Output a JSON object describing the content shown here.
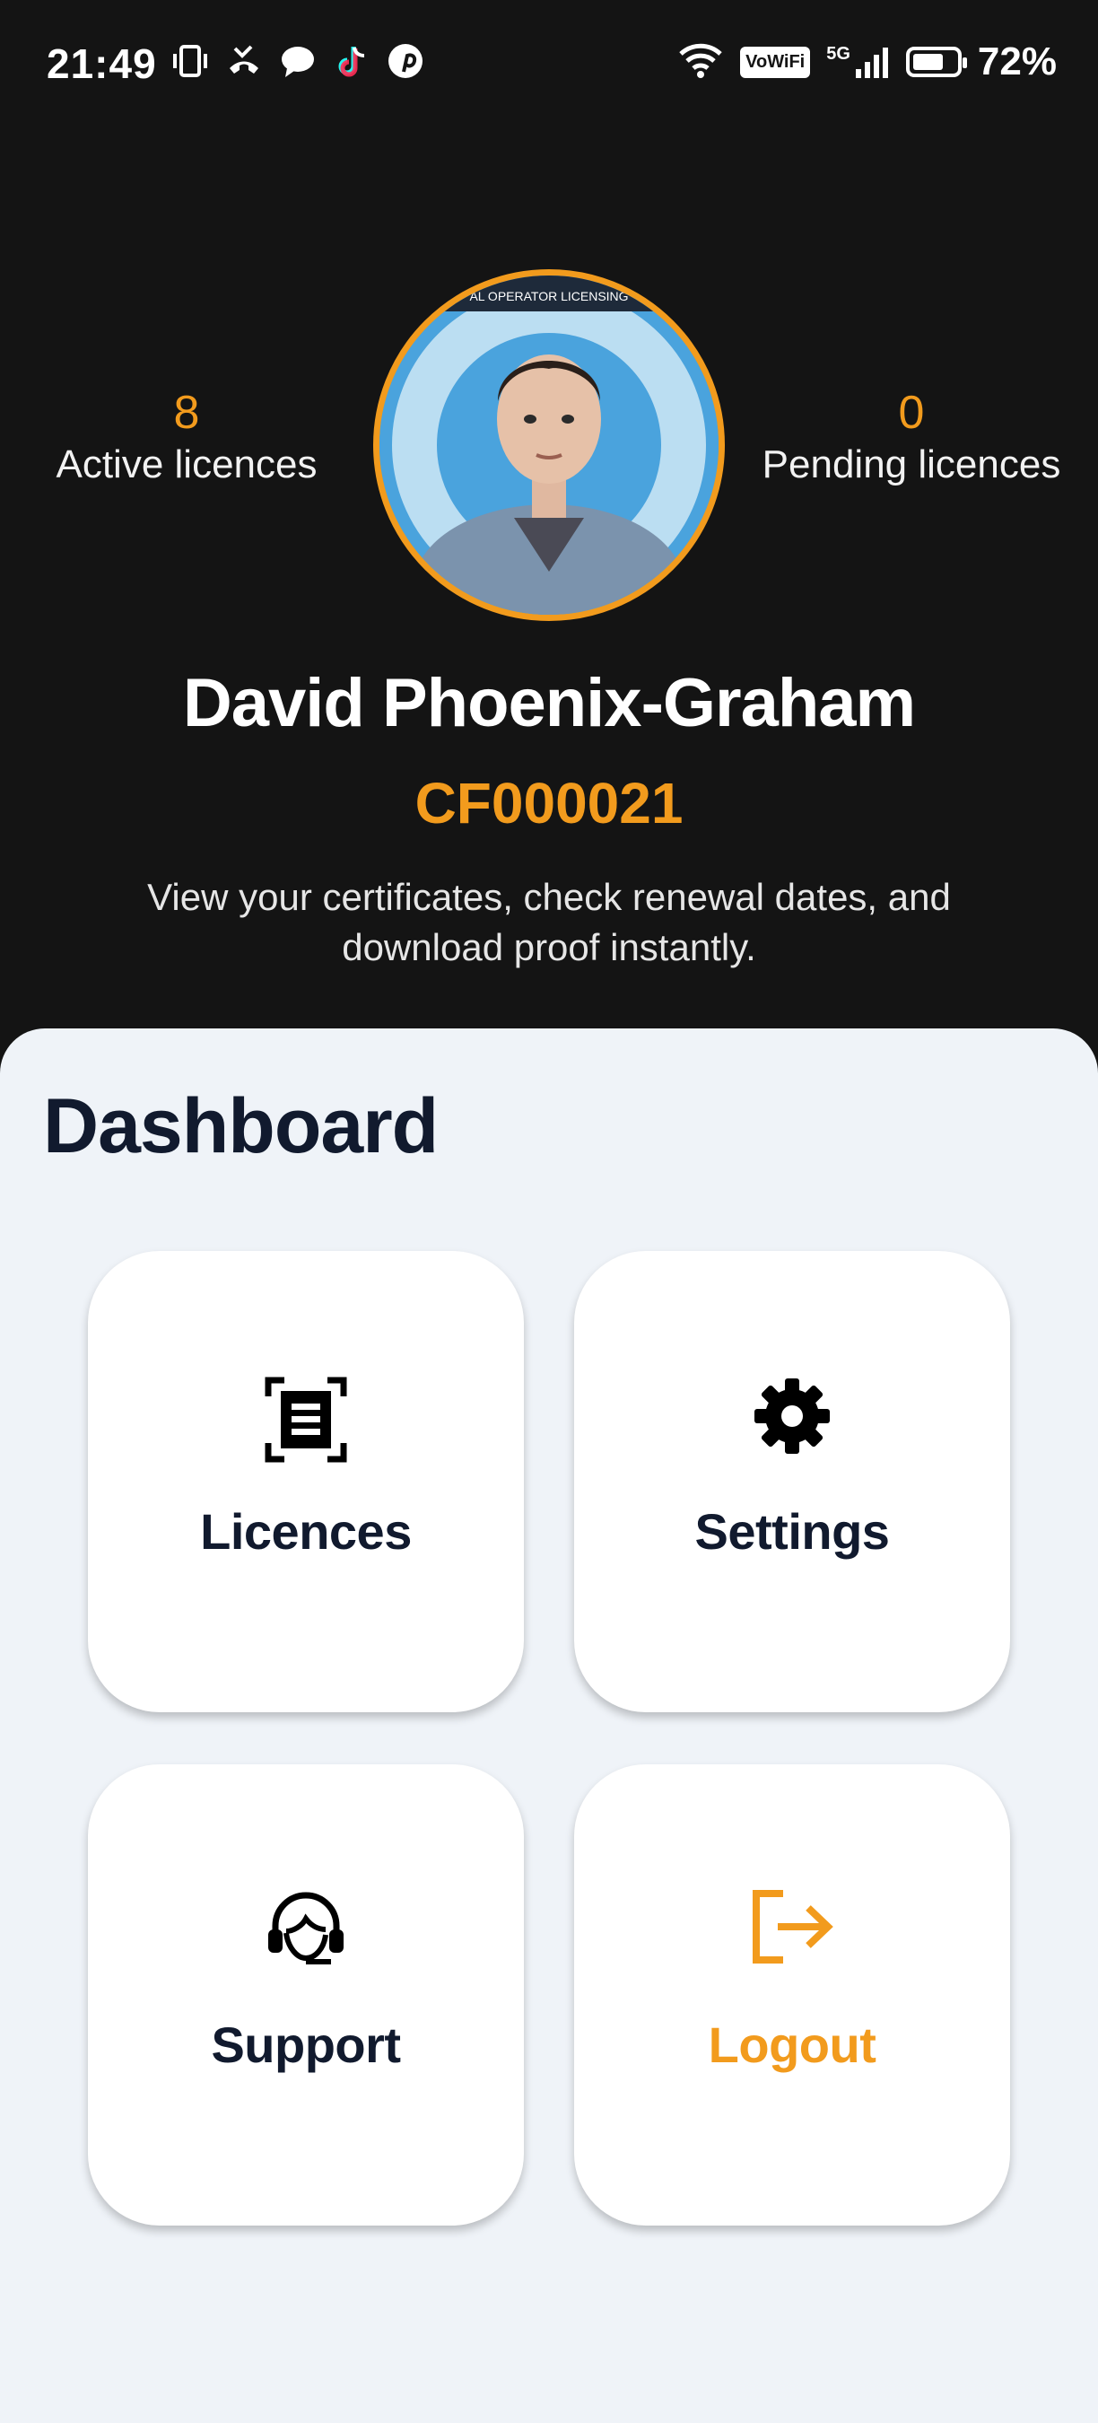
{
  "status_bar": {
    "time": "21:49",
    "wifi_badge": "VoWiFi",
    "network": "5G",
    "battery_percent": "72%",
    "battery_level": 0.72
  },
  "profile": {
    "active_count": "8",
    "active_label": "Active licences",
    "pending_count": "0",
    "pending_label": "Pending licences",
    "name": "David Phoenix-Graham",
    "id": "CF000021",
    "intro": "View your certificates, check renewal dates, and download proof instantly.",
    "avatar_banner_text": "AL OPERATOR LICENSING"
  },
  "dashboard": {
    "title": "Dashboard",
    "tiles": [
      {
        "label": "Licences",
        "icon": "licence-document-icon"
      },
      {
        "label": "Settings",
        "icon": "gear-icon"
      },
      {
        "label": "Support",
        "icon": "headset-icon"
      },
      {
        "label": "Logout",
        "icon": "logout-icon"
      }
    ]
  },
  "colors": {
    "accent": "#F29B1D",
    "header_bg": "#141414",
    "panel_bg": "#EFF3F8",
    "text_dark": "#111a2e"
  }
}
